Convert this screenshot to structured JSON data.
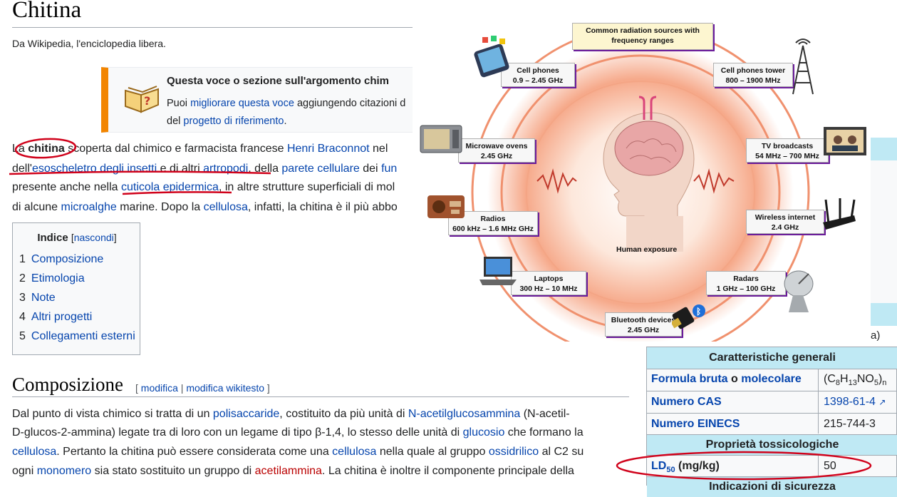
{
  "article": {
    "title": "Chitina",
    "tagline": "Da Wikipedia, l'enciclopedia libera."
  },
  "ambox": {
    "title": "Questa voce o sezione sull'argomento chim",
    "line1_pre": "Puoi ",
    "line1_link": "migliorare questa voce",
    "line1_post": " aggiungendo citazioni d",
    "line2_pre": "del ",
    "line2_link": "progetto di riferimento",
    "line2_post": "."
  },
  "intro": {
    "l1": {
      "a": "La ",
      "b": "chitina",
      "c": " scoperta dal chimico e farmacista francese ",
      "d": "Henri Braconnot",
      "e": " nel"
    },
    "l2": {
      "a": "dell'",
      "b": "esoscheletro degli insetti",
      "c": " e di altri ",
      "d": "artropodi",
      "e": ", della ",
      "f": "parete cellulare",
      "g": " dei ",
      "h": "fun"
    },
    "l3": {
      "a": "presente anche nella ",
      "b": "cuticola epidermica",
      "c": ", in altre strutture superficiali di mol"
    },
    "l4": {
      "a": "di alcune ",
      "b": "microalghe",
      "c": " marine. Dopo la ",
      "d": "cellulosa",
      "e": ", infatti, la chitina è il più abbo"
    }
  },
  "toc": {
    "title": "Indice",
    "toggle": "nascondi",
    "items": [
      {
        "num": "1",
        "label": "Composizione"
      },
      {
        "num": "2",
        "label": "Etimologia"
      },
      {
        "num": "3",
        "label": "Note"
      },
      {
        "num": "4",
        "label": "Altri progetti"
      },
      {
        "num": "5",
        "label": "Collegamenti esterni"
      }
    ]
  },
  "section": {
    "heading": "Composizione",
    "edit": "modifica",
    "edit_source": "modifica wikitesto"
  },
  "body": {
    "p1": {
      "a": "Dal punto di vista chimico si tratta di un ",
      "b": "polisaccaride",
      "c": ", costituito da più unità di ",
      "d": "N-acetilglucosammina",
      "e": " (N-acetil-"
    },
    "p2": {
      "a": "D-glucos-2-ammina) legate tra di loro con un legame di tipo β-1,4, lo stesso delle unità di ",
      "b": "glucosio",
      "c": " che formano la"
    },
    "p3": {
      "a": "cellulosa",
      "b": ". Pertanto la chitina può essere considerata come una ",
      "c": "cellulosa",
      "d": " nella quale al gruppo ",
      "e": "ossidrilico",
      "f": " al C2 su"
    },
    "p4": {
      "a": "ogni ",
      "b": "monomero",
      "c": " sia stato sostituito un gruppo di ",
      "d": "acetilammina",
      "e": ". La chitina è inoltre il componente principale della"
    }
  },
  "infobox": {
    "header_general": "Caratteristiche generali",
    "formula_key_a": "Formula bruta",
    "formula_key_o": " o ",
    "formula_key_b": "molecolare",
    "formula_value": "(C8H13NO5)n",
    "cas_key": "Numero CAS",
    "cas_value": "1398-61-4",
    "einecs_key": "Numero EINECS",
    "einecs_value": "215-744-3",
    "header_tox": "Proprietà tossicologiche",
    "ld50_key": "LD50",
    "ld50_unit": " (mg/kg)",
    "ld50_value": "50",
    "header_safety": "Indicazioni di sicurezza",
    "side_glyph": "a)"
  },
  "overlay": {
    "center_title": "Common radiation sources with frequency ranges",
    "human_label": "Human exposure",
    "cards": [
      {
        "name": "Cell phones",
        "range": "0.9 – 2.45 GHz"
      },
      {
        "name": "Cell phones tower",
        "range": "800 – 1900 MHz"
      },
      {
        "name": "Microwave ovens",
        "range": "2.45 GHz"
      },
      {
        "name": "TV broadcasts",
        "range": "54 MHz – 700 MHz"
      },
      {
        "name": "Radios",
        "range": "600 kHz – 1.6 MHz GHz"
      },
      {
        "name": "Wireless internet",
        "range": "2.4 GHz"
      },
      {
        "name": "Laptops",
        "range": "300 Hz – 10 MHz"
      },
      {
        "name": "Radars",
        "range": "1 GHz – 100 GHz"
      },
      {
        "name": "Bluetooth devices",
        "range": "2.45 GHz"
      }
    ]
  },
  "colors": {
    "link": "#0645ad",
    "redlink": "#ba0000",
    "ambox_border": "#f28500",
    "infobox_header": "#bfe9f4",
    "annotation_red": "#d0021b"
  }
}
